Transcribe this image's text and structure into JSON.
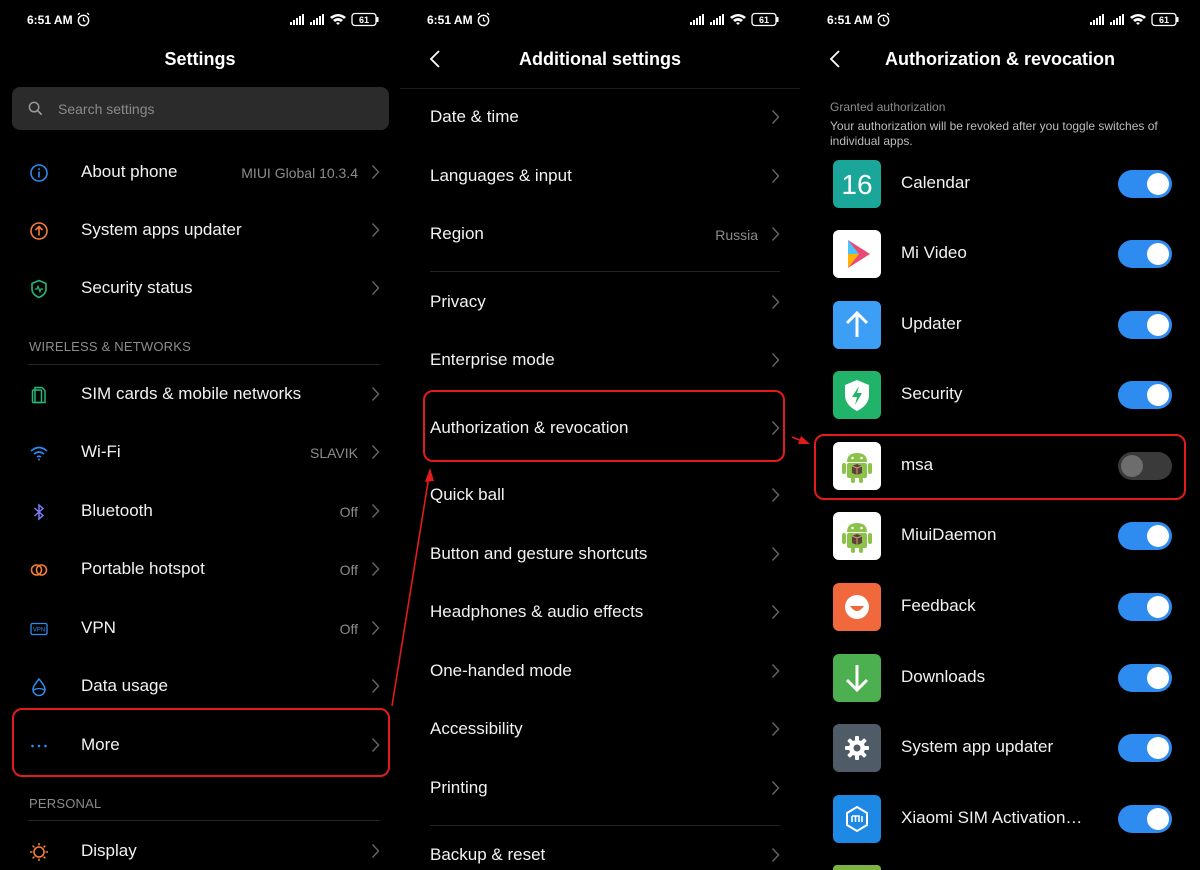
{
  "status_bar": {
    "time": "6:51 AM",
    "battery": "61"
  },
  "screen1": {
    "title": "Settings",
    "search_placeholder": "Search settings",
    "items_top": [
      {
        "label": "About phone",
        "value": "MIUI Global 10.3.4",
        "icon": "info-icon"
      },
      {
        "label": "System apps updater",
        "value": "",
        "icon": "update-icon"
      },
      {
        "label": "Security status",
        "value": "",
        "icon": "shield-icon"
      }
    ],
    "section_wireless": "WIRELESS & NETWORKS",
    "items_wireless": [
      {
        "label": "SIM cards & mobile networks",
        "value": "",
        "icon": "sim-icon"
      },
      {
        "label": "Wi-Fi",
        "value": "SLAVIK",
        "icon": "wifi-icon"
      },
      {
        "label": "Bluetooth",
        "value": "Off",
        "icon": "bluetooth-icon"
      },
      {
        "label": "Portable hotspot",
        "value": "Off",
        "icon": "hotspot-icon"
      },
      {
        "label": "VPN",
        "value": "Off",
        "icon": "vpn-icon"
      },
      {
        "label": "Data usage",
        "value": "",
        "icon": "data-usage-icon"
      },
      {
        "label": "More",
        "value": "",
        "icon": "more-icon"
      }
    ],
    "section_personal": "PERSONAL",
    "items_personal": [
      {
        "label": "Display",
        "value": "",
        "icon": "display-icon"
      }
    ]
  },
  "screen2": {
    "title": "Additional settings",
    "items": [
      {
        "label": "Date & time",
        "value": ""
      },
      {
        "label": "Languages & input",
        "value": ""
      },
      {
        "label": "Region",
        "value": "Russia"
      },
      {
        "label": "Privacy",
        "value": ""
      },
      {
        "label": "Enterprise mode",
        "value": ""
      },
      {
        "label": "Authorization & revocation",
        "value": ""
      },
      {
        "label": "Quick ball",
        "value": ""
      },
      {
        "label": "Button and gesture shortcuts",
        "value": ""
      },
      {
        "label": "Headphones & audio effects",
        "value": ""
      },
      {
        "label": "One-handed mode",
        "value": ""
      },
      {
        "label": "Accessibility",
        "value": ""
      },
      {
        "label": "Printing",
        "value": ""
      },
      {
        "label": "Backup & reset",
        "value": ""
      }
    ]
  },
  "screen3": {
    "title": "Authorization & revocation",
    "granted_heading": "Granted authorization",
    "granted_description": "Your authorization will be revoked after you toggle switches of individual apps.",
    "apps": [
      {
        "name": "Calendar",
        "enabled": true,
        "icon": "calendar-icon",
        "icon_text": "16",
        "color": "#1aa79a"
      },
      {
        "name": "Mi Video",
        "enabled": true,
        "icon": "mi-video-icon",
        "color": "#ffffff"
      },
      {
        "name": "Updater",
        "enabled": true,
        "icon": "updater-icon",
        "color": "#3d9ef5"
      },
      {
        "name": "Security",
        "enabled": true,
        "icon": "security-icon",
        "color": "#21b36a"
      },
      {
        "name": "msa",
        "enabled": false,
        "icon": "android-icon",
        "color": "#ffffff"
      },
      {
        "name": "MiuiDaemon",
        "enabled": true,
        "icon": "android-icon",
        "color": "#ffffff"
      },
      {
        "name": "Feedback",
        "enabled": true,
        "icon": "feedback-icon",
        "color": "#f1683d"
      },
      {
        "name": "Downloads",
        "enabled": true,
        "icon": "downloads-icon",
        "color": "#4caf50"
      },
      {
        "name": "System app updater",
        "enabled": true,
        "icon": "gear-icon",
        "color": "#4f5b66"
      },
      {
        "name": "Xiaomi SIM Activation…",
        "enabled": true,
        "icon": "mi-sim-icon",
        "color": "#1e88e5"
      }
    ]
  },
  "colors": {
    "accent": "#2e8bf0",
    "highlight": "#e21b1b",
    "background": "#000000"
  }
}
